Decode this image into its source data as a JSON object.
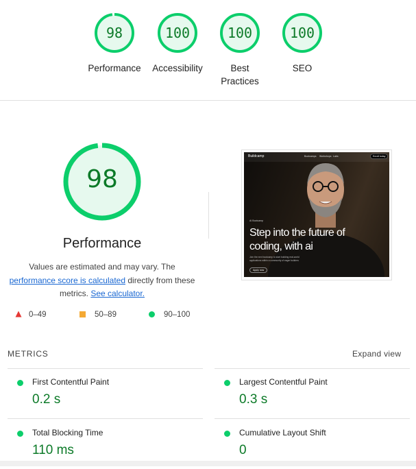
{
  "summary_gauges": [
    {
      "score": "98",
      "label": "Performance",
      "fraction": 0.98
    },
    {
      "score": "100",
      "label": "Accessibility",
      "fraction": 1.0
    },
    {
      "score": "100",
      "label": "Best Practices",
      "fraction": 1.0
    },
    {
      "score": "100",
      "label": "SEO",
      "fraction": 1.0
    }
  ],
  "performance": {
    "score": "98",
    "fraction": 0.98,
    "title": "Performance",
    "desc_part1": "Values are estimated and may vary. The ",
    "link1": "performance score is calculated",
    "desc_part2": " directly from these metrics. ",
    "link2": "See calculator."
  },
  "legend": [
    {
      "range": "0–49",
      "shape": "triangle",
      "color": "#e53935"
    },
    {
      "range": "50–89",
      "shape": "square",
      "color": "#f4a934"
    },
    {
      "range": "90–100",
      "shape": "circle",
      "color": "#0cce6b"
    }
  ],
  "screenshot": {
    "logo": "Buildcamp",
    "nav": [
      "Bootcamps",
      "Workshops",
      "Labs"
    ],
    "cta": "Enroll today",
    "eyebrow": "AI Bootcamp",
    "headline_line1": "Step into the future of",
    "headline_line2": "coding, with ai",
    "subtext": "Join the next bootcamp to start building real-world applications within a community of eager builders",
    "button": "Apply now"
  },
  "metrics": {
    "header": "METRICS",
    "expand": "Expand view",
    "items": [
      {
        "name": "First Contentful Paint",
        "value": "0.2 s"
      },
      {
        "name": "Largest Contentful Paint",
        "value": "0.3 s"
      },
      {
        "name": "Total Blocking Time",
        "value": "110 ms"
      },
      {
        "name": "Cumulative Layout Shift",
        "value": "0"
      }
    ]
  },
  "colors": {
    "pass": "#0cce6b",
    "pass_text": "#0c7a28",
    "pass_fill": "#e6f9ee"
  }
}
